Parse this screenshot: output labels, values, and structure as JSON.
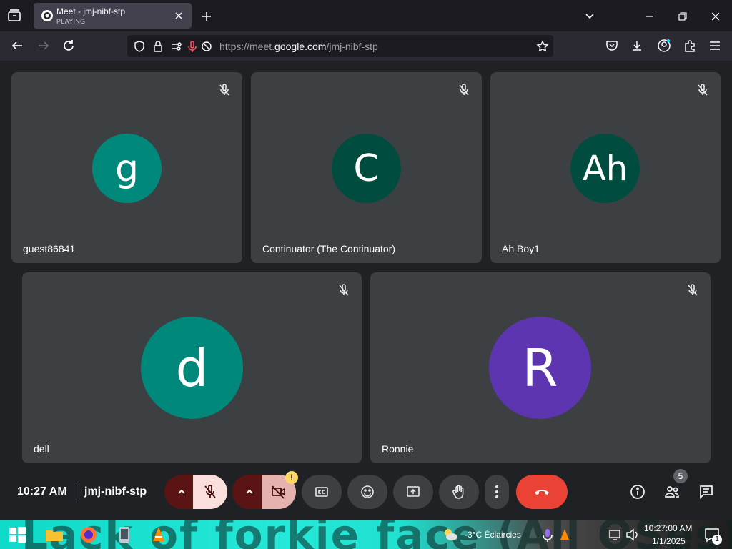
{
  "browser": {
    "tab": {
      "title": "Meet - jmj-nibf-stp",
      "status": "PLAYING"
    },
    "url": {
      "prefix": "https://meet.",
      "domain": "google.com",
      "path": "/jmj-nibf-stp"
    }
  },
  "participants": [
    {
      "name": "guest86841",
      "initial": "g",
      "color": "#00897b"
    },
    {
      "name": "Continuator (The Continuator)",
      "initial": "C",
      "color": "#004d40"
    },
    {
      "name": "Ah Boy1",
      "initial": "Ah",
      "color": "#004d40"
    },
    {
      "name": "dell",
      "initial": "d",
      "color": "#00897b"
    },
    {
      "name": "Ronnie",
      "initial": "R",
      "color": "#5e35b1"
    }
  ],
  "controls": {
    "time": "10:27 AM",
    "meeting_code": "jmj-nibf-stp",
    "camera_warning": "!",
    "people_count": "5"
  },
  "taskbar": {
    "banner": "Lack of forkie face (All OSes)",
    "weather": "-3°C Éclaircies",
    "time": "10:27:00 AM",
    "date": "1/1/2025",
    "notifications": "1"
  }
}
